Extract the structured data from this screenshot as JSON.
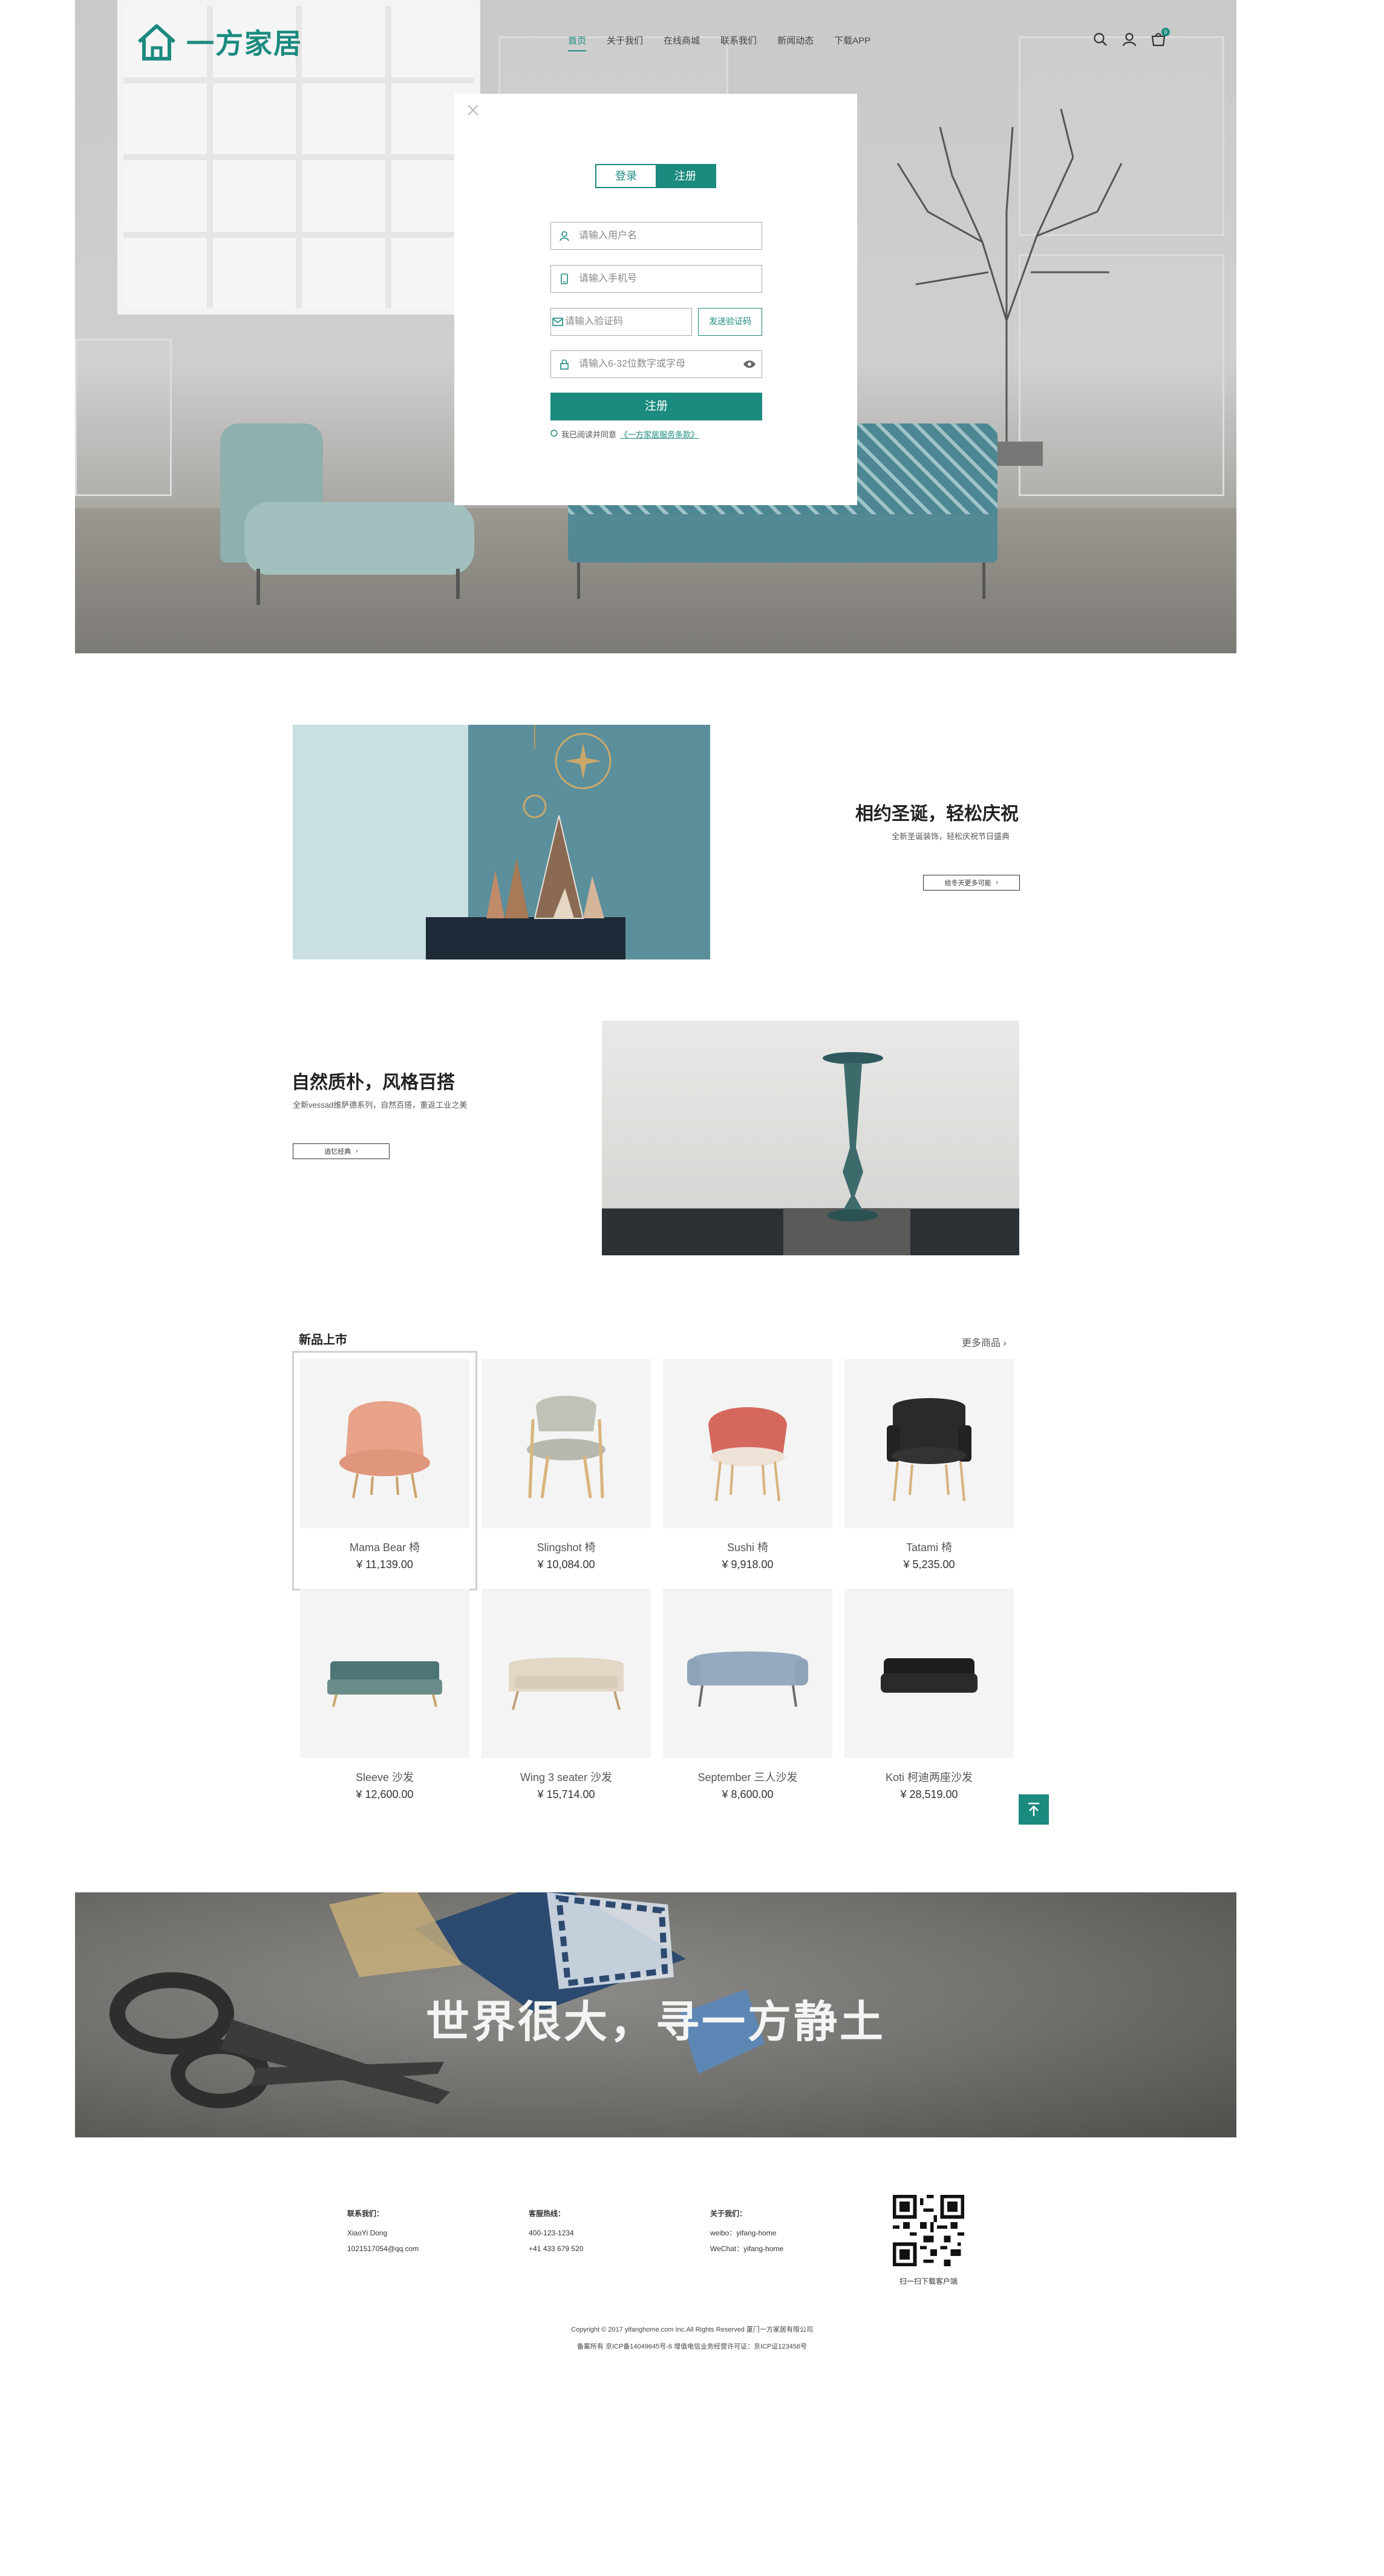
{
  "header": {
    "logo_text": "一方家居",
    "nav": [
      {
        "label": "首页",
        "active": true
      },
      {
        "label": "关于我们"
      },
      {
        "label": "在线商城"
      },
      {
        "label": "联系我们"
      },
      {
        "label": "新闻动态"
      },
      {
        "label": "下载APP"
      }
    ],
    "cart_count": "0",
    "icons": [
      "search-icon",
      "user-icon",
      "cart-icon"
    ]
  },
  "modal": {
    "tab_login": "登录",
    "tab_register": "注册",
    "username_placeholder": "请输入用户名",
    "phone_placeholder": "请输入手机号",
    "code_placeholder": "请输入验证码",
    "send_code": "发送验证码",
    "password_placeholder": "请输入6-32位数字或字母",
    "submit": "注册",
    "agree_text": "我已阅读并同意",
    "agree_link": "《一方家居服务条款》"
  },
  "features": [
    {
      "title": "相约圣诞，轻松庆祝",
      "subtitle": "全新圣诞装饰，轻松庆祝节日盛典",
      "button": "给冬天更多可能"
    },
    {
      "title": "自然质朴，风格百搭",
      "subtitle": "全新vessad维萨德系列，自然百搭，重返工业之美",
      "button": "追忆经典"
    }
  ],
  "products": {
    "title": "新品上市",
    "more": "更多商品",
    "items": [
      {
        "name": "Mama Bear 椅",
        "price": "¥ 11,139.00"
      },
      {
        "name": "Slingshot  椅",
        "price": "¥ 10,084.00"
      },
      {
        "name": "Sushi 椅",
        "price": "¥ 9,918.00"
      },
      {
        "name": "Tatami 椅",
        "price": "¥ 5,235.00"
      },
      {
        "name": "Sleeve 沙发",
        "price": "¥ 12,600.00"
      },
      {
        "name": "Wing 3 seater 沙发",
        "price": "¥ 15,714.00"
      },
      {
        "name": "September 三人沙发",
        "price": "¥ 8,600.00"
      },
      {
        "name": "Koti 柯迪两座沙发",
        "price": "¥ 28,519.00"
      }
    ]
  },
  "banner": {
    "slogan": "世界很大，寻一方静土"
  },
  "footer": {
    "contact_title": "联系我们：",
    "contact_name": "XiaoYi Dong",
    "contact_email": "1021517054@qq.com",
    "hotline_title": "客服热线：",
    "hotline_1": "400-123-1234",
    "hotline_2": "+41 433 679 520",
    "about_title": "关于我们：",
    "weibo": "weibo：yifang-home",
    "wechat": "WeChat：yifang-home",
    "qr_caption": "扫一扫下载客户端",
    "copyright": "Copyright © 2017 yifanghome.com Inc.All Rights Reserved  厦门一方家居有限公司",
    "icp": "备案所有  京ICP备14049645号-6  增值电信业务经营许可证：京ICP证123456号"
  }
}
